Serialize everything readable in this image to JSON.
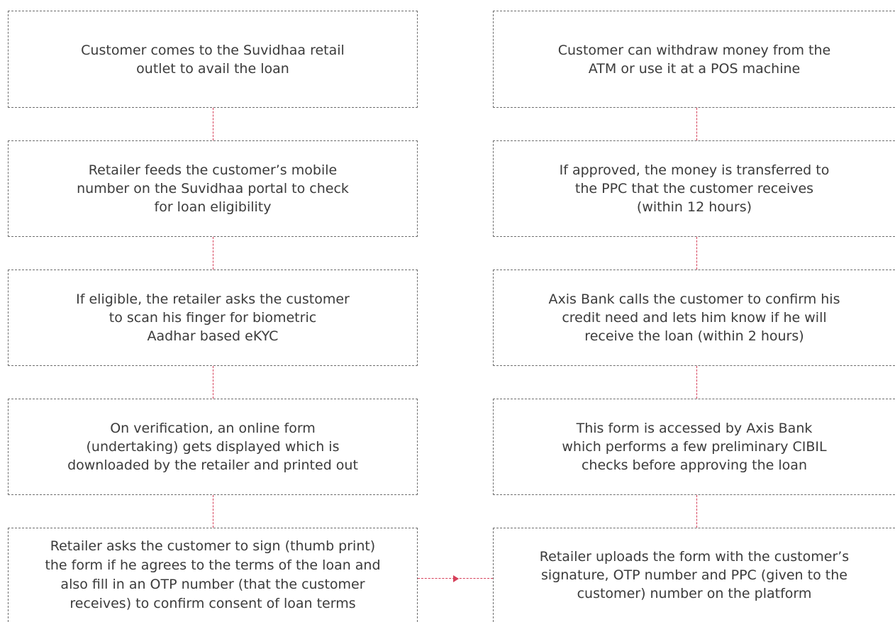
{
  "colors": {
    "box_border": "#6e6e6e",
    "connector": "#d6405a",
    "text": "#3b3b3b"
  },
  "left_column": [
    {
      "text": "Customer comes to the Suvidhaa retail\noutlet to avail the loan"
    },
    {
      "text": "Retailer feeds the customer’s mobile\nnumber on the Suvidhaa portal to check\nfor loan eligibility"
    },
    {
      "text": "If eligible, the retailer asks the customer\nto scan his finger for biometric\nAadhar based eKYC"
    },
    {
      "text": "On verification, an online form\n(undertaking) gets displayed which is\ndownloaded by the retailer and printed out"
    },
    {
      "text": "Retailer asks the customer to sign (thumb print)\nthe form if he agrees to the terms of the loan and\nalso fill in an OTP number (that the customer\nreceives) to confirm consent of loan terms"
    }
  ],
  "right_column": [
    {
      "text": "Customer can withdraw money from the\nATM or use it at a POS machine"
    },
    {
      "text": "If approved, the money is transferred to\nthe PPC that the customer receives\n(within 12 hours)"
    },
    {
      "text": "Axis Bank calls the customer to confirm his\ncredit need and lets him know if he will\nreceive the loan (within 2 hours)"
    },
    {
      "text": "This form is accessed by Axis Bank\nwhich performs a few preliminary CIBIL\nchecks before approving the loan"
    },
    {
      "text": "Retailer uploads the form with the customer’s\nsignature, OTP number and PPC (given to the\ncustomer) number on the platform"
    }
  ]
}
